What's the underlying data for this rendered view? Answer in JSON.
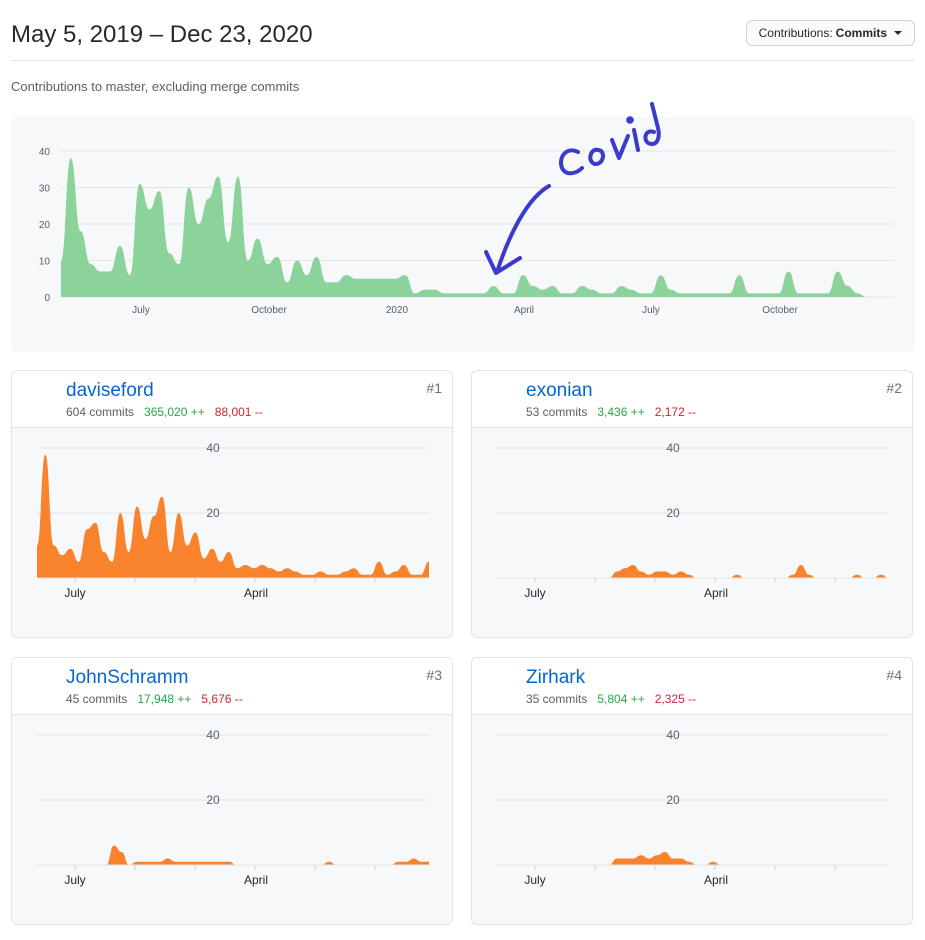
{
  "header": {
    "date_range": "May 5, 2019 – Dec 23, 2020",
    "dropdown_label": "Contributions:",
    "dropdown_value": "Commits"
  },
  "subtitle": "Contributions to master, excluding merge commits",
  "main_chart": {
    "type": "area",
    "y_ticks": [
      "40",
      "30",
      "20",
      "10",
      "0"
    ],
    "x_labels": [
      "July",
      "October",
      "2020",
      "April",
      "July",
      "October"
    ],
    "color": "#8cd29b",
    "annotation_text": "Covid",
    "annotation_color": "#3a3acb"
  },
  "contributors": [
    {
      "rank": "#1",
      "name": "daviseford",
      "commits": "604 commits",
      "additions": "365,020 ++",
      "deletions": "88,001 --"
    },
    {
      "rank": "#2",
      "name": "exonian",
      "commits": "53 commits",
      "additions": "3,436 ++",
      "deletions": "2,172 --"
    },
    {
      "rank": "#3",
      "name": "JohnSchramm",
      "commits": "45 commits",
      "additions": "17,948 ++",
      "deletions": "5,676 --"
    },
    {
      "rank": "#4",
      "name": "Zirhark",
      "commits": "35 commits",
      "additions": "5,804 ++",
      "deletions": "2,325 --"
    }
  ],
  "card_chart": {
    "y_ticks": [
      "40",
      "20"
    ],
    "x_labels": [
      "July",
      "April"
    ],
    "color": "#f9822c"
  },
  "chart_data": [
    {
      "type": "area",
      "title": "",
      "ylim": [
        0,
        40
      ],
      "x_labels": [
        "July",
        "October",
        "2020",
        "April",
        "July",
        "October"
      ],
      "x": [
        0,
        1,
        2,
        3,
        4,
        5,
        6,
        7,
        8,
        9,
        10,
        11,
        12,
        13,
        14,
        15,
        16,
        17,
        18,
        19,
        20,
        21,
        22,
        23,
        24,
        25,
        26,
        27,
        28,
        29,
        30,
        31,
        32,
        33,
        34,
        35,
        36,
        37,
        38,
        39,
        40,
        41,
        42,
        43,
        44,
        45,
        46,
        47,
        48,
        49,
        50,
        51,
        52,
        53,
        54,
        55,
        56,
        57,
        58,
        59,
        60,
        61,
        62,
        63,
        64,
        65,
        66,
        67,
        68,
        69,
        70,
        71,
        72,
        73,
        74,
        75,
        76,
        77,
        78,
        79,
        80,
        81,
        82,
        83
      ],
      "values": [
        10,
        38,
        18,
        9,
        7,
        7,
        14,
        6,
        31,
        24,
        29,
        12,
        9,
        30,
        20,
        27,
        33,
        15,
        33,
        10,
        16,
        9,
        11,
        4,
        10,
        6,
        11,
        4,
        4,
        6,
        5,
        5,
        5,
        5,
        5,
        6,
        1,
        2,
        2,
        1,
        1,
        1,
        1,
        1,
        3,
        1,
        1,
        6,
        3,
        2,
        3,
        1,
        1,
        3,
        2,
        1,
        1,
        3,
        2,
        1,
        1,
        6,
        2,
        1,
        1,
        1,
        1,
        1,
        1,
        6,
        1,
        1,
        1,
        1,
        7,
        1,
        1,
        1,
        1,
        7,
        3,
        1,
        0,
        0
      ],
      "series": [
        {
          "values": "values"
        }
      ]
    },
    {
      "type": "area",
      "title": "daviseford",
      "ylim": [
        0,
        40
      ],
      "x_labels": [
        "July",
        "April"
      ],
      "values": [
        10,
        38,
        10,
        7,
        9,
        5,
        15,
        17,
        8,
        5,
        20,
        8,
        22,
        12,
        19,
        25,
        8,
        20,
        10,
        14,
        6,
        9,
        5,
        8,
        3,
        4,
        3,
        4,
        3,
        2,
        3,
        2,
        1,
        1,
        2,
        1,
        1,
        2,
        3,
        1,
        1,
        5,
        1,
        2,
        4,
        1,
        1,
        5
      ]
    },
    {
      "type": "area",
      "title": "exonian",
      "ylim": [
        0,
        40
      ],
      "x_labels": [
        "July",
        "April"
      ],
      "values": [
        0,
        0,
        0,
        0,
        0,
        0,
        0,
        0,
        0,
        0,
        0,
        0,
        0,
        0,
        0,
        2,
        3,
        4,
        2,
        1,
        2,
        2,
        1,
        2,
        1,
        0,
        0,
        0,
        0,
        0,
        1,
        0,
        0,
        0,
        0,
        0,
        0,
        1,
        4,
        1,
        0,
        0,
        0,
        0,
        0,
        1,
        0,
        0,
        1,
        0
      ]
    },
    {
      "type": "area",
      "title": "JohnSchramm",
      "ylim": [
        0,
        40
      ],
      "x_labels": [
        "July",
        "April"
      ],
      "values": [
        0,
        0,
        0,
        0,
        0,
        0,
        0,
        0,
        0,
        0,
        6,
        4,
        0,
        1,
        1,
        1,
        1,
        2,
        1,
        1,
        1,
        1,
        1,
        1,
        1,
        1,
        0,
        0,
        0,
        0,
        0,
        0,
        0,
        0,
        0,
        0,
        0,
        0,
        1,
        0,
        0,
        0,
        0,
        0,
        0,
        0,
        0,
        1,
        1,
        2,
        1,
        1
      ]
    },
    {
      "type": "area",
      "title": "Zirhark",
      "ylim": [
        0,
        40
      ],
      "x_labels": [
        "July",
        "April"
      ],
      "values": [
        0,
        0,
        0,
        0,
        0,
        0,
        0,
        0,
        0,
        0,
        0,
        0,
        0,
        0,
        0,
        2,
        2,
        2,
        3,
        2,
        3,
        4,
        2,
        2,
        1,
        0,
        0,
        1,
        0,
        0,
        0,
        0,
        0,
        0,
        0,
        0,
        0,
        0,
        0,
        0,
        0,
        0,
        0,
        0,
        0,
        0,
        0,
        0,
        0,
        0
      ]
    }
  ]
}
